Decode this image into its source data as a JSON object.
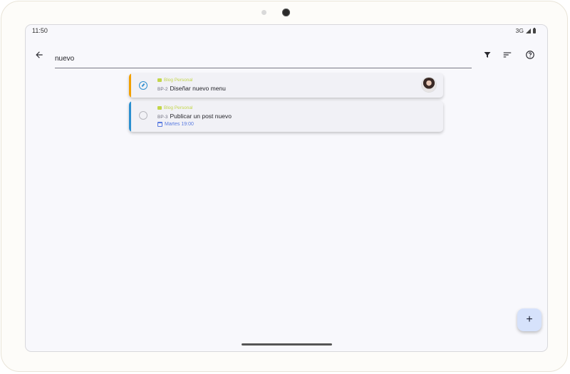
{
  "status_bar": {
    "time": "11:50",
    "network": "3G"
  },
  "search": {
    "query": "nuevo"
  },
  "toolbar": {
    "back_icon": "arrow-back-icon",
    "filter_icon": "filter-icon",
    "sort_icon": "sort-icon",
    "help_icon": "help-icon"
  },
  "tasks": [
    {
      "project": "Blog Personal",
      "id": "BP-2",
      "title": "Diseñar nuevo menu",
      "status": "in-progress",
      "accent_color": "#f2a000"
    },
    {
      "project": "Blog Personal",
      "id": "BP-3",
      "title": "Publicar un post nuevo",
      "status": "todo",
      "due": "Martes 19:00",
      "accent_color": "#2a8fd0"
    }
  ],
  "fab": {
    "label": "+"
  },
  "colors": {
    "project": "#c3d64a",
    "due": "#5a7be0",
    "fab": "#d6e2fb"
  }
}
